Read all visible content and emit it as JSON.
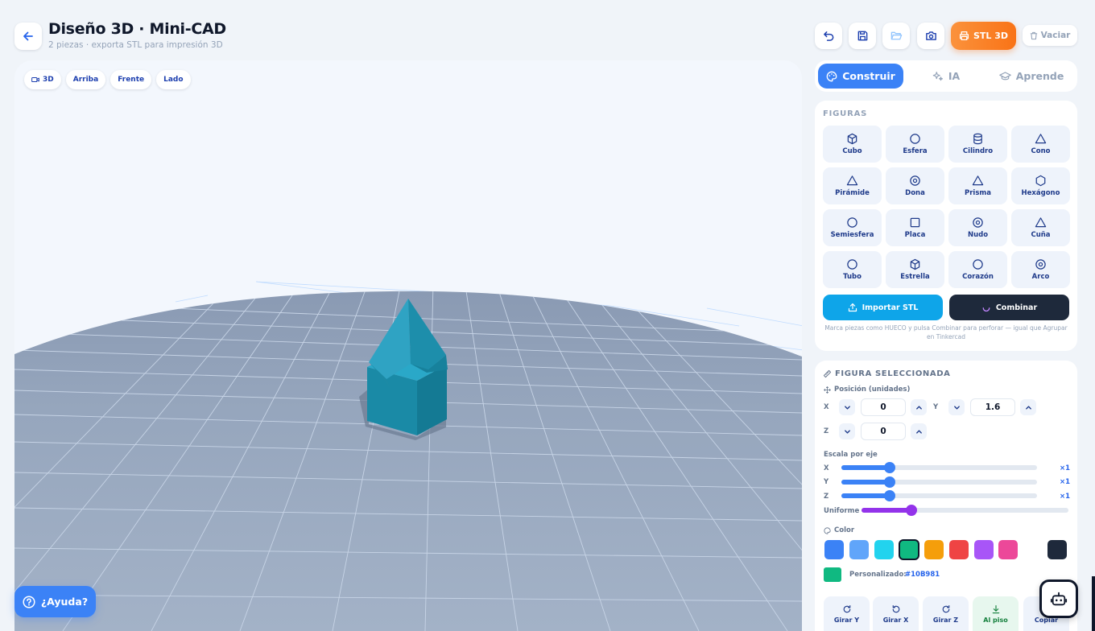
{
  "header": {
    "title": "Diseño 3D · Mini-CAD",
    "subtitle": "2 piezas · exporta STL para impresión 3D"
  },
  "toolbar": {
    "stl_label": "STL 3D",
    "vaciar_label": "Vaciar",
    "icons": [
      "undo-icon",
      "save-icon",
      "folder-open-icon",
      "camera-icon"
    ]
  },
  "viewport": {
    "view_buttons": [
      "3D",
      "Arriba",
      "Frente",
      "Lado"
    ]
  },
  "help": {
    "label": "¿Ayuda?"
  },
  "tabs": [
    {
      "label": "Construir",
      "active": true
    },
    {
      "label": "IA",
      "active": false
    },
    {
      "label": "Aprende",
      "active": false
    }
  ],
  "figures": {
    "heading": "FIGURAS",
    "items": [
      "Cubo",
      "Esfera",
      "Cilindro",
      "Cono",
      "Pirámide",
      "Dona",
      "Prisma",
      "Hexágono",
      "Semiesfera",
      "Placa",
      "Nudo",
      "Cuña",
      "Tubo",
      "Estrella",
      "Corazón",
      "Arco"
    ],
    "import_label": "Importar STL",
    "combine_label": "Combinar",
    "hint": "Marca piezas como HUECO y pulsa Combinar para perforar — igual que Agrupar en Tinkercad"
  },
  "selected": {
    "heading": "FIGURA SELECCIONADA",
    "position_label": "Posición (unidades)",
    "axis_x": "X",
    "axis_y": "Y",
    "axis_z": "Z",
    "pos_x": "0",
    "pos_y": "1.6",
    "pos_z": "0",
    "scale_label": "Escala por eje",
    "uniform_label": "Uniforme",
    "scale_x": "×1",
    "scale_y": "×1",
    "scale_z": "×1",
    "scale_x_value": 1,
    "scale_y_value": 1,
    "scale_z_value": 1,
    "color_label": "Color",
    "swatches": [
      "#3b82f6",
      "#60a5fa",
      "#22d3ee",
      "#10b981",
      "#f59e0b",
      "#ef4444",
      "#a855f7",
      "#ec4899",
      "#1e293b"
    ],
    "selected_color": "#10b981",
    "custom_label": "Personalizado:",
    "custom_value": "#10B981",
    "actions": [
      "Girar Y",
      "Girar X",
      "Girar Z",
      "Al piso",
      "Copiar"
    ]
  },
  "colors": {
    "accent": "#3b82f6",
    "orange": "#f97316",
    "model": "#1f9bb8"
  }
}
